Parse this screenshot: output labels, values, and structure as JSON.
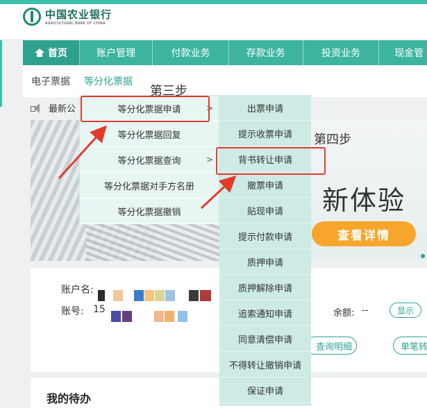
{
  "bank": {
    "name_cn": "中国农业银行",
    "name_en": "AGRICULTURAL BANK OF CHINA"
  },
  "nav": {
    "items": [
      "首页",
      "账户管理",
      "付款业务",
      "存款业务",
      "投资业务",
      "现金管"
    ]
  },
  "subnav": {
    "items": [
      "电子票据",
      "等分化票据"
    ]
  },
  "notice": {
    "text": "最新公"
  },
  "banner": {
    "title": "新体验",
    "button": "查看详情"
  },
  "account": {
    "name_label": "账户名:",
    "number_label": "账号:",
    "number_prefix": "15",
    "balance_label": "余额:",
    "balance_value": "--",
    "show_button": "显示",
    "detail_button": "查询明细",
    "single_button": "单笔转"
  },
  "todo": {
    "title": "我的待办"
  },
  "menu_level1": {
    "items": [
      "等分化票据申请",
      "等分化票据回复",
      "等分化票据查询",
      "等分化票据对手方名册",
      "等分化票据撤销"
    ],
    "arrow": ">"
  },
  "menu_level2": {
    "items": [
      "出票申请",
      "提示收票申请",
      "背书转让申请",
      "撤票申请",
      "贴现申请",
      "提示付款申请",
      "质押申请",
      "质押解除申请",
      "追索通知申请",
      "同意清偿申请",
      "不得转让撤销申请",
      "保证申请"
    ]
  },
  "annotations": {
    "step3": "第三步",
    "step4": "第四步"
  },
  "colors": {
    "brand": "#3cb4a0",
    "accent": "#2aa390",
    "highlight": "#e23b2e",
    "button": "#f7a62b"
  }
}
